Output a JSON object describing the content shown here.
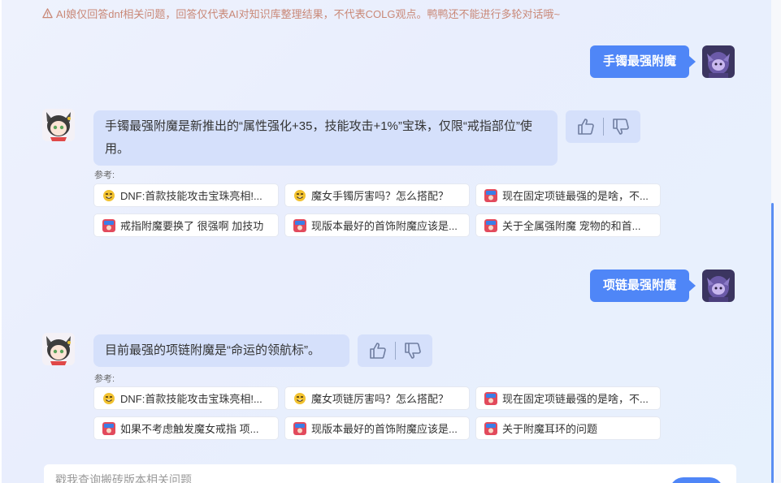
{
  "notice": "AI娘仅回答dnf相关问题，回答仅代表AI对知识库整理结果，不代表COLG观点。鸭鸭还不能进行多轮对话哦~",
  "conversation": [
    {
      "question": "手镯最强附魔",
      "answer": "手镯最强附魔是新推出的“属性强化+35，技能攻击+1%”宝珠，仅限“戒指部位”使用。",
      "ref_label": "参考:",
      "refs": [
        {
          "icon": "emoji-icon",
          "text": "DNF:首款技能攻击宝珠亮相!..."
        },
        {
          "icon": "emoji-icon",
          "text": "魔女手镯厉害吗？怎么搭配？"
        },
        {
          "icon": "colg-icon",
          "text": "现在固定项链最强的是啥，不..."
        },
        {
          "icon": "colg-icon",
          "text": "戒指附魔要换了 很强啊 加技功"
        },
        {
          "icon": "colg-icon",
          "text": "现版本最好的首饰附魔应该是..."
        },
        {
          "icon": "colg-icon",
          "text": "关于全属强附魔 宠物的和首..."
        }
      ]
    },
    {
      "question": "项链最强附魔",
      "answer": "目前最强的项链附魔是“命运的领航标”。",
      "ref_label": "参考:",
      "refs": [
        {
          "icon": "emoji-icon",
          "text": "DNF:首款技能攻击宝珠亮相!..."
        },
        {
          "icon": "emoji-icon",
          "text": "魔女项链厉害吗？怎么搭配？"
        },
        {
          "icon": "colg-icon",
          "text": "现在固定项链最强的是啥，不..."
        },
        {
          "icon": "colg-icon",
          "text": "如果不考虑触发魔女戒指 项..."
        },
        {
          "icon": "colg-icon",
          "text": "现版本最好的首饰附魔应该是..."
        },
        {
          "icon": "colg-icon",
          "text": "关于附魔耳环的问题"
        }
      ]
    }
  ],
  "input": {
    "placeholder": "戳我查询搬砖版本相关问题"
  },
  "colors": {
    "accent": "#4f86f7",
    "ai_bubble": "#d5e0fb",
    "notice": "#c98877"
  }
}
